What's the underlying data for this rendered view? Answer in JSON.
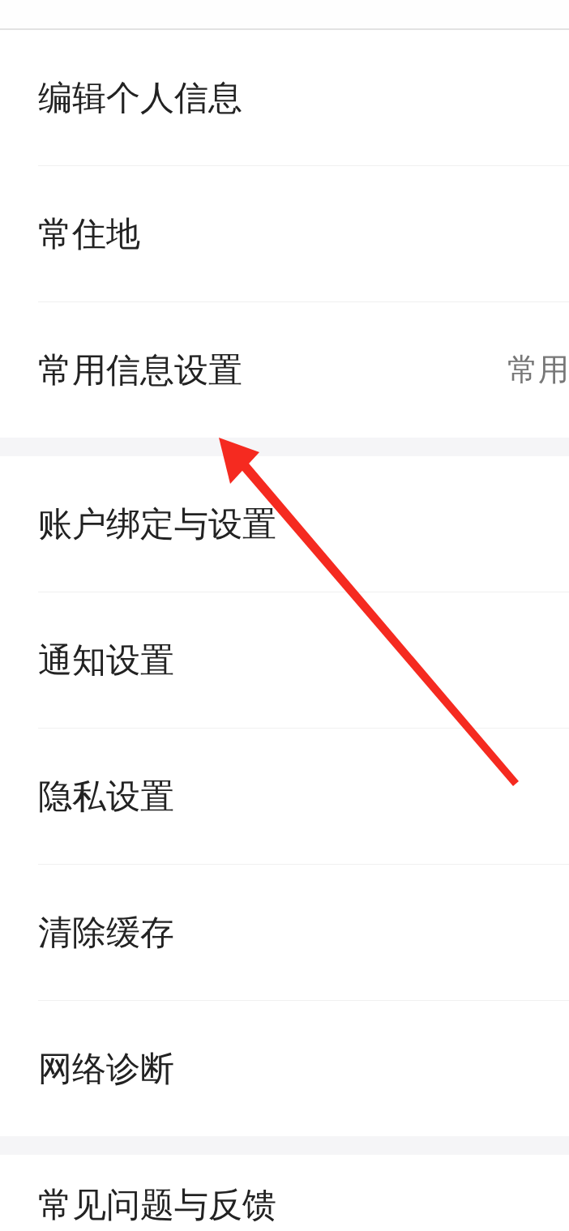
{
  "sections": [
    {
      "items": [
        {
          "label": "编辑个人信息"
        },
        {
          "label": "常住地"
        },
        {
          "label": "常用信息设置",
          "value": "常用"
        }
      ]
    },
    {
      "items": [
        {
          "label": "账户绑定与设置"
        },
        {
          "label": "通知设置"
        },
        {
          "label": "隐私设置"
        },
        {
          "label": "清除缓存"
        },
        {
          "label": "网络诊断"
        }
      ]
    },
    {
      "items": [
        {
          "label": "常见问题与反馈"
        }
      ]
    }
  ]
}
